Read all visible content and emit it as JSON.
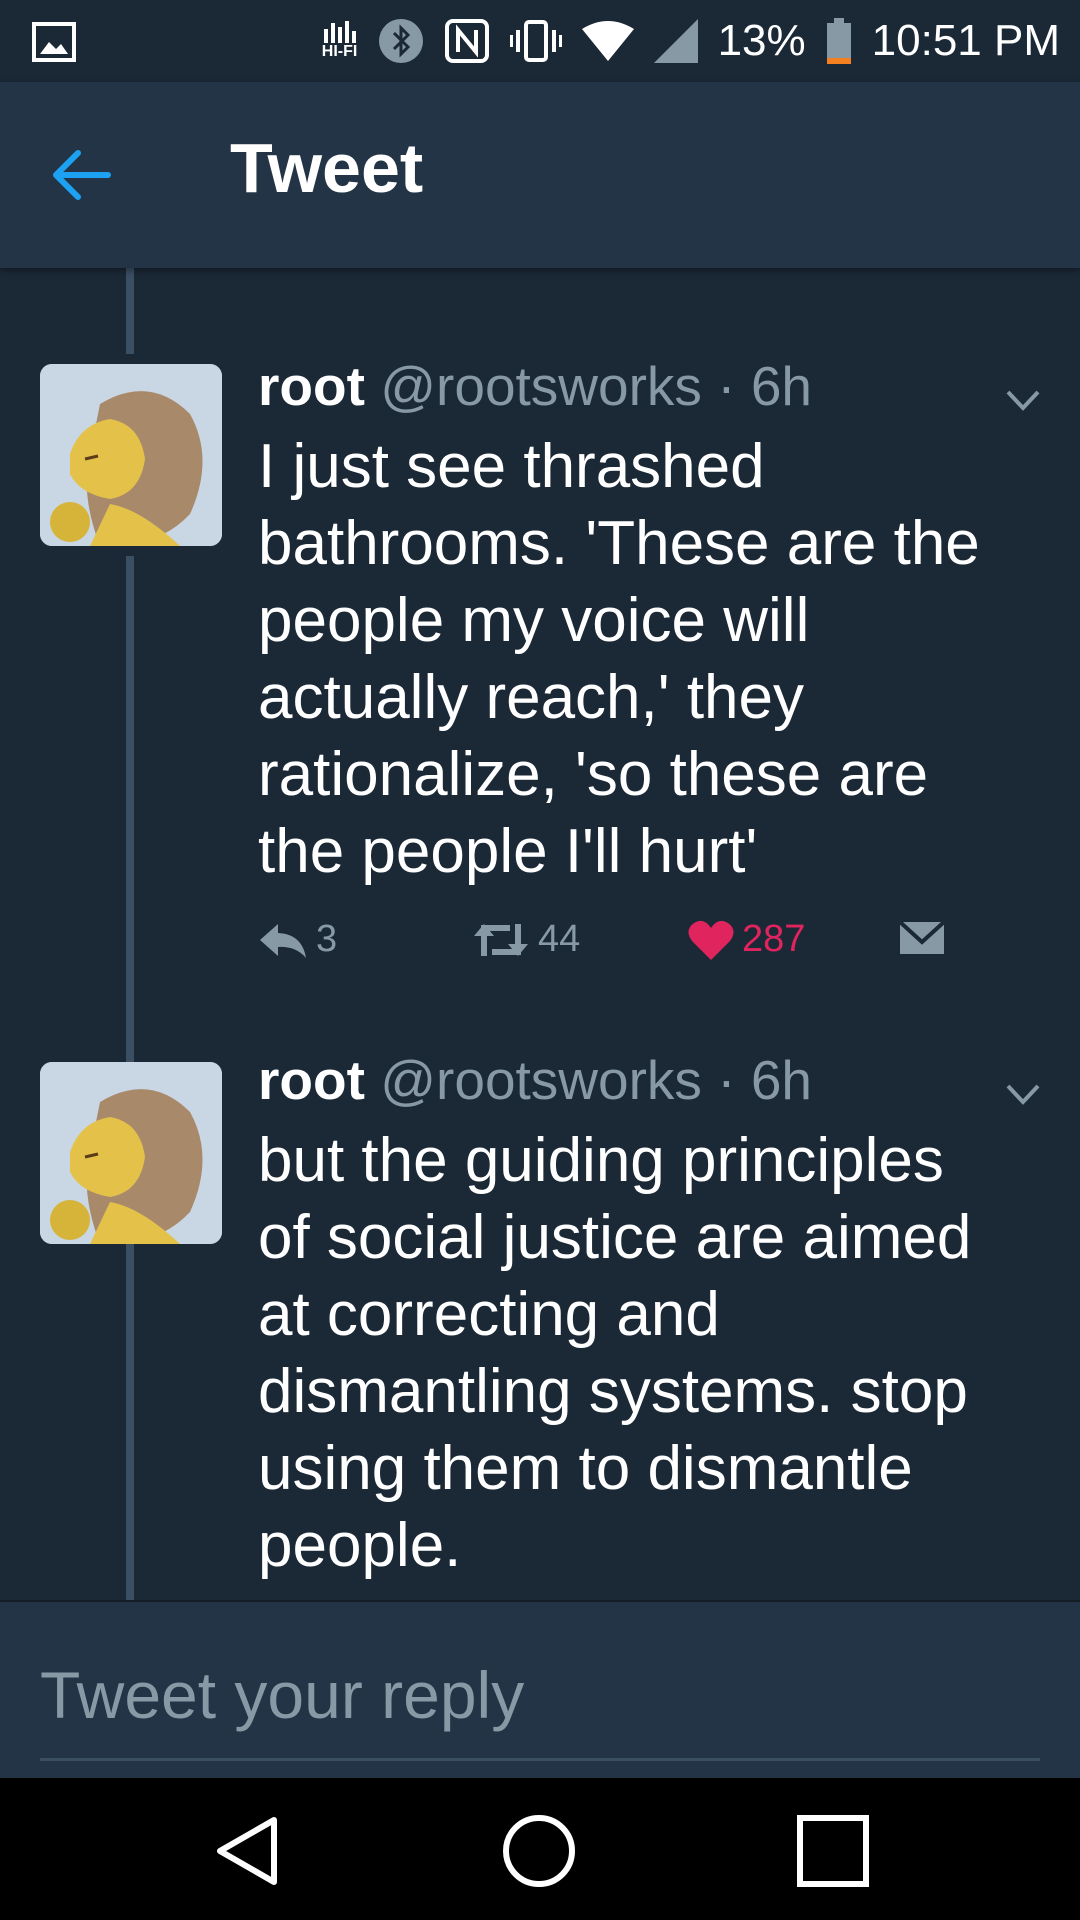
{
  "status_bar": {
    "icons": [
      "gallery-icon",
      "hifi-icon",
      "bluetooth-icon",
      "nfc-icon",
      "vibrate-icon",
      "wifi-icon",
      "signal-icon",
      "battery-icon"
    ],
    "hifi_label": "HI-FI",
    "battery": "13%",
    "time": "10:51 PM"
  },
  "header": {
    "title": "Tweet",
    "back_icon": "arrow-left-icon"
  },
  "colors": {
    "background": "#1b2836",
    "header": "#243447",
    "accent": "#1da1f2",
    "like": "#e0245e",
    "muted": "#8899a6"
  },
  "tweets": [
    {
      "name": "root",
      "handle": "@rootsworks",
      "time": "· 6h",
      "text_lines": [
        "I just see thrashed",
        "bathrooms. 'These are the",
        "people my voice will",
        "actually reach,' they",
        "rationalize, 'so these are",
        "the people I'll hurt'"
      ],
      "replies": "3",
      "retweets": "44",
      "likes": "287"
    },
    {
      "name": "root",
      "handle": "@rootsworks",
      "time": "· 6h",
      "text_lines": [
        "but the guiding principles",
        "of social justice are aimed",
        "at correcting and",
        "dismantling systems. stop",
        "using them to dismantle",
        "people."
      ]
    }
  ],
  "reply_box": {
    "placeholder": "Tweet your reply"
  },
  "nav_bar": {
    "icons": [
      "back-triangle-icon",
      "home-circle-icon",
      "recents-square-icon"
    ]
  }
}
